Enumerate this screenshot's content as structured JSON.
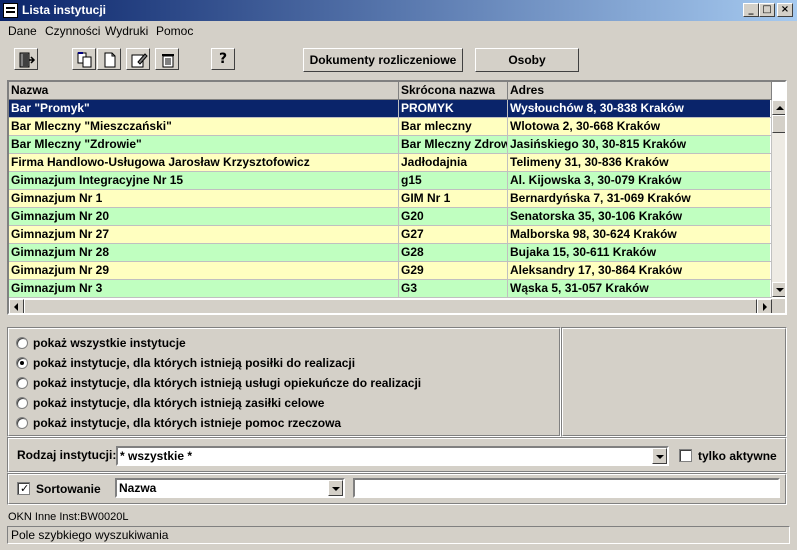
{
  "window": {
    "title": "Lista instytucji"
  },
  "menu": [
    "Dane",
    "Czynności",
    "Wydruki",
    "Pomoc"
  ],
  "toolbar": {
    "icons": [
      "exit-icon",
      "copy-icon",
      "new-document-icon",
      "edit-icon",
      "delete-icon",
      "help-icon"
    ],
    "help_glyph": "?",
    "documents_button": "Dokumenty rozliczeniowe",
    "persons_button": "Osoby"
  },
  "table": {
    "columns": [
      "Nazwa",
      "Skrócona nazwa",
      "Adres"
    ],
    "rows": [
      {
        "name": "Bar \"Promyk\"",
        "short": "PROMYK",
        "address": "Wysłouchów 8, 30-838 Kraków",
        "selected": true
      },
      {
        "name": "Bar Mleczny \"Mieszczański\"",
        "short": "Bar mleczny",
        "address": "Wlotowa 2, 30-668 Kraków"
      },
      {
        "name": "Bar Mleczny \"Zdrowie\"",
        "short": "Bar Mleczny Zdrowie",
        "address": "Jasińskiego 30, 30-815 Kraków"
      },
      {
        "name": "Firma Handlowo-Usługowa Jarosław Krzysztofowicz",
        "short": "Jadłodajnia",
        "address": "Telimeny 31, 30-836 Kraków"
      },
      {
        "name": "Gimnazjum Integracyjne Nr 15",
        "short": "g15",
        "address": "Al. Kijowska 3, 30-079 Kraków"
      },
      {
        "name": "Gimnazjum Nr 1",
        "short": "GIM Nr 1",
        "address": "Bernardyńska 7, 31-069 Kraków"
      },
      {
        "name": "Gimnazjum Nr 20",
        "short": "G20",
        "address": "Senatorska 35, 30-106 Kraków"
      },
      {
        "name": "Gimnazjum Nr 27",
        "short": "G27",
        "address": "Malborska 98, 30-624 Kraków"
      },
      {
        "name": "Gimnazjum Nr 28",
        "short": "G28",
        "address": "Bujaka 15, 30-611 Kraków"
      },
      {
        "name": "Gimnazjum Nr 29",
        "short": "G29",
        "address": "Aleksandry 17, 30-864 Kraków"
      },
      {
        "name": "Gimnazjum Nr 3",
        "short": "G3",
        "address": "Wąska 5, 31-057 Kraków"
      }
    ]
  },
  "filters": {
    "options": [
      "pokaż wszystkie instytucje",
      "pokaż instytucje, dla których istnieją posiłki do realizacji",
      "pokaż instytucje, dla których istnieją usługi opiekuńcze do realizacji",
      "pokaż instytucje, dla których istnieją zasiłki celowe",
      "pokaż instytucje, dla których istnieje pomoc rzeczowa"
    ],
    "selected_index": 1
  },
  "institution_type": {
    "label": "Rodzaj instytucji:",
    "value": "* wszystkie *"
  },
  "active_only": {
    "label": "tylko aktywne",
    "checked": false
  },
  "sorting": {
    "label": "Sortowanie",
    "checked": true,
    "field": "Nazwa",
    "search_value": ""
  },
  "status": {
    "code": "OKN Inne Inst:BW0020L",
    "hint": "Pole szybkiego wyszukiwania"
  },
  "colors": {
    "row_a": "#ffffc0",
    "row_b": "#c0ffc0",
    "selected": "#0a246a",
    "selected_text": "#ffffff"
  }
}
